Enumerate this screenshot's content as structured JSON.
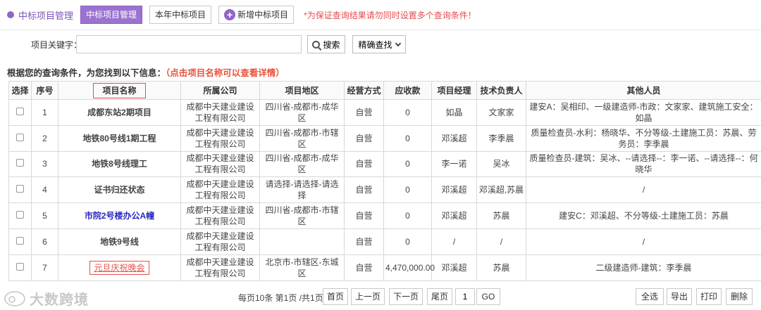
{
  "header": {
    "module_title": "中标项目管理",
    "tab_active": "中标项目管理",
    "tab_year": "本年中标项目",
    "add_button": "新增中标项目",
    "warning": "*为保证查询结果请勿同时设置多个查询条件！"
  },
  "search": {
    "label": "项目关键字：",
    "value": "",
    "button": "搜索",
    "precise": "精确查找"
  },
  "result": {
    "text": "根据您的查询条件，为您找到以下信息：",
    "hint": "（点击项目名称可以查看详情）"
  },
  "table": {
    "columns": [
      "选择",
      "序号",
      "项目名称",
      "所属公司",
      "项目地区",
      "经营方式",
      "应收款",
      "项目经理",
      "技术负责人",
      "其他人员"
    ],
    "rows": [
      {
        "no": "1",
        "name": "成都东站2期项目",
        "company": "成都中天建业建设工程有限公司",
        "region": "四川省-成都市-成华区",
        "mode": "自营",
        "amount": "0",
        "manager": "如晶",
        "tech": "文家家",
        "others": "建安A：吴相印、一级建造师-市政：文家家、建筑施工安全：如晶"
      },
      {
        "no": "2",
        "name": "地铁80号线1期工程",
        "company": "成都中天建业建设工程有限公司",
        "region": "四川省-成都市-市辖区",
        "mode": "自营",
        "amount": "0",
        "manager": "邓溪超",
        "tech": "李季晨",
        "others": "质量检查员-水利：杨晓华、不分等级-土建施工员：苏晨、劳务员：李季晨"
      },
      {
        "no": "3",
        "name": "地铁8号线理工",
        "company": "成都中天建业建设工程有限公司",
        "region": "四川省-成都市-成华区",
        "mode": "自营",
        "amount": "0",
        "manager": "李一诺",
        "tech": "吴冰",
        "others": "质量检查员-建筑：吴冰、--请选择--：李一诺、--请选择--：何晓华"
      },
      {
        "no": "4",
        "name": "证书归还状态",
        "company": "成都中天建业建设工程有限公司",
        "region": "请选择-请选择-请选择",
        "mode": "自营",
        "amount": "0",
        "manager": "邓溪超",
        "tech": "邓溪超,苏晨",
        "others": "/"
      },
      {
        "no": "5",
        "name": "市院2号楼办公A幢",
        "company": "成都中天建业建设工程有限公司",
        "region": "四川省-成都市-市辖区",
        "mode": "自营",
        "amount": "0",
        "manager": "邓溪超",
        "tech": "苏晨",
        "others": "建安C：邓溪超、不分等级-土建施工员：苏晨"
      },
      {
        "no": "6",
        "name": "地铁9号线",
        "company": "成都中天建业建设工程有限公司",
        "region": "",
        "mode": "自营",
        "amount": "0",
        "manager": "/",
        "tech": "/",
        "others": "/"
      },
      {
        "no": "7",
        "name": "元旦庆祝晚会",
        "company": "成都中天建业建设工程有限公司",
        "region": "北京市-市辖区-东城区",
        "mode": "自营",
        "amount": "4,470,000.00",
        "manager": "邓溪超",
        "tech": "苏晨",
        "others": "二级建造师-建筑：李季晨"
      }
    ]
  },
  "pager": {
    "info": "每页10条 第1页 /共1页",
    "first": "首页",
    "prev": "上一页",
    "next": "下一页",
    "last": "尾页",
    "page_value": "1",
    "go": "GO"
  },
  "actions": {
    "select_all": "全选",
    "export": "导出",
    "print": "打印",
    "delete": "删除"
  },
  "watermark": "大数跨境",
  "colors": {
    "accent": "#9b72d0",
    "warning": "#e84a4a",
    "link_red": "#e8524a",
    "link_blue": "#2a2ac0"
  }
}
